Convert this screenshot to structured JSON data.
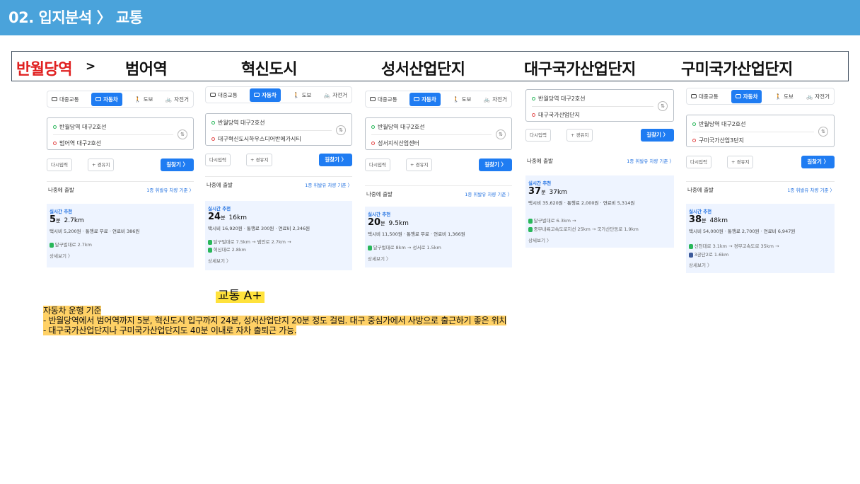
{
  "header": {
    "title": "02. 입지분석 〉 교통"
  },
  "route_bar": {
    "items": [
      "반월당역",
      "범어역",
      "혁신도시",
      "성서산업단지",
      "대구국가산업단지",
      "구미국가산업단지"
    ],
    "arrow": ">"
  },
  "colors": {
    "header": "#4aa3db",
    "accent": "#1f7cf2",
    "highlight": "#ffd166",
    "first_item": "#e02020"
  },
  "tabs": {
    "transit": "대중교통",
    "car": "자동차",
    "walk": "도보",
    "bike": "자전거"
  },
  "common": {
    "reenter": "다시입력",
    "waypoint": "+ 경유지",
    "go": "길찾기 〉",
    "depart_later": "나중에 출발",
    "criteria": "1종 휘발유 차량 기준 〉",
    "recommend": "실시간 추천",
    "minute_unit": "분",
    "detail": "상세보기 〉",
    "swap_icon": "⇅"
  },
  "cards": [
    {
      "from": "반월당역 대구2호선",
      "to": "범어역 대구2호선",
      "minutes": "5",
      "distance": "2.7km",
      "fare": "택시비 5,200원 · 통행료 무료 · 연료비 386원",
      "roads": [
        "달구벌대로 2.7km"
      ]
    },
    {
      "from": "반월당역 대구2호선",
      "to": "대구혁신도시하우스디어반에가시티",
      "minutes": "24",
      "distance": "16km",
      "fare": "택시비 16,920원 · 통행료 300원 · 연료비 2,346원",
      "roads": [
        "달구벌대로 7.5km → 범안로 2.7km →",
        "혁신대로 2.8km"
      ]
    },
    {
      "from": "반월당역 대구2호선",
      "to": "성서지식산업센터",
      "minutes": "20",
      "distance": "9.5km",
      "fare": "택시비 11,500원 · 통행료 무료 · 연료비 1,366원",
      "roads": [
        "달구벌대로 8km → 성서로 1.5km"
      ]
    },
    {
      "from": "반월당역 대구2호선",
      "to": "대구국가산업단지",
      "minutes": "37",
      "distance": "37km",
      "fare": "택시비 35,620원 · 통행료 2,000원 · 연료비 5,314원",
      "roads": [
        "달구벌대로 6.3km →",
        "중부내륙고속도로지선 25km → 국가산단동로 1.9km"
      ]
    },
    {
      "from": "반월당역 대구2호선",
      "to": "구미국가산업3단지",
      "minutes": "38",
      "distance": "48km",
      "fare": "택시비 54,000원 · 통행료 2,700원 · 연료비 6,947원",
      "roads": [
        "신천대로 3.1km → 경부고속도로 35km →",
        "3공단2로 1.6km"
      ]
    }
  ],
  "summary": {
    "grade": "교통 A+",
    "lines": [
      "자동차 운행 기준",
      " - 반월당역에서 범어역까지 5분, 혁신도시 입구까지 24분, 성서산업단지 20분 정도 걸림. 대구 중심가에서 사방으로 출근하기 좋은 위치",
      " - 대구국가산업단지나 구미국가산업단지도 40분 이내로 자차 출퇴근 가능."
    ]
  }
}
